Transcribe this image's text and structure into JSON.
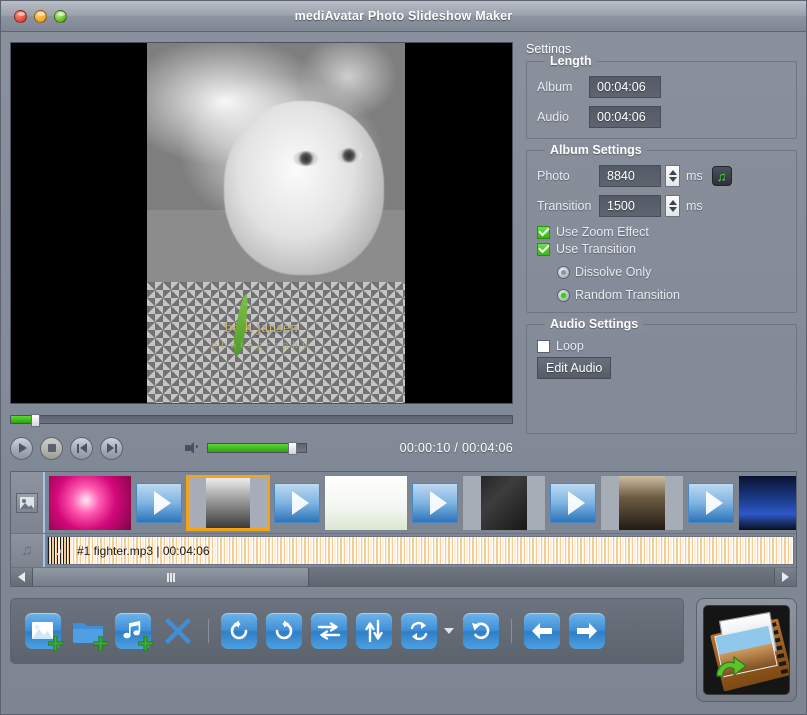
{
  "window": {
    "title": "mediAvatar Photo Slideshow Maker",
    "traffic_lights": [
      "close",
      "minimize",
      "maximize"
    ]
  },
  "preview": {
    "watermark_main": "beth jansen",
    "watermark_sub": "photography"
  },
  "player": {
    "play_label": "Play",
    "stop_label": "Stop",
    "previous_label": "Previous",
    "next_label": "Next",
    "volume_label": "Volume",
    "seek_percent": 4,
    "volume_percent": 82,
    "timecode": "00:00:10 / 00:04:06",
    "current_time": "00:00:10",
    "total_time": "00:04:06"
  },
  "settings": {
    "title": "Settings",
    "length": {
      "legend": "Length",
      "album_label": "Album",
      "album_value": "00:04:06",
      "audio_label": "Audio",
      "audio_value": "00:04:06"
    },
    "album": {
      "legend": "Album Settings",
      "photo_label": "Photo",
      "photo_value": "8840",
      "photo_unit": "ms",
      "transition_label": "Transition",
      "transition_value": "1500",
      "transition_unit": "ms",
      "zoom_effect_label": "Use Zoom Effect",
      "zoom_effect_checked": true,
      "use_transition_label": "Use Transition",
      "use_transition_checked": true,
      "dissolve_only_label": "Dissolve Only",
      "dissolve_only_selected": false,
      "random_transition_label": "Random Transition",
      "random_transition_selected": true
    },
    "audio": {
      "legend": "Audio Settings",
      "loop_label": "Loop",
      "loop_checked": false,
      "edit_audio_label": "Edit Audio"
    }
  },
  "timeline": {
    "photo_track_icon": "image-icon",
    "audio_track_icon": "music-note-icon",
    "items": [
      {
        "type": "photo",
        "name": "orchid-flower-thumbnail",
        "class": "img-orchid",
        "selected": false,
        "letterbox": false
      },
      {
        "type": "transition",
        "name": "transition-marker"
      },
      {
        "type": "photo",
        "name": "child-portrait-thumbnail",
        "class": "img-girl",
        "selected": true,
        "letterbox": true
      },
      {
        "type": "transition",
        "name": "transition-marker"
      },
      {
        "type": "photo",
        "name": "white-tulips-thumbnail",
        "class": "img-tulip",
        "selected": false,
        "letterbox": false
      },
      {
        "type": "transition",
        "name": "transition-marker"
      },
      {
        "type": "photo",
        "name": "dark-portrait-thumbnail",
        "class": "img-dark",
        "selected": false,
        "letterbox": true
      },
      {
        "type": "transition",
        "name": "transition-marker"
      },
      {
        "type": "photo",
        "name": "woman-portrait-thumbnail",
        "class": "img-lady",
        "selected": false,
        "letterbox": true
      },
      {
        "type": "transition",
        "name": "transition-marker"
      },
      {
        "type": "photo",
        "name": "night-building-thumbnail",
        "class": "img-city",
        "selected": false,
        "letterbox": false
      }
    ],
    "audio_clip": {
      "label": "#1 fighter.mp3 | 00:04:06",
      "track_number": "#1",
      "filename": "fighter.mp3",
      "duration": "00:04:06"
    },
    "scrollbar": {
      "left_arrow": "scroll-left",
      "right_arrow": "scroll-right"
    }
  },
  "toolbar": {
    "buttons": [
      {
        "name": "add-photo-button",
        "icon": "image-plus-icon",
        "label": "Add Photo"
      },
      {
        "name": "add-folder-button",
        "icon": "folder-plus-icon",
        "label": "Add Folder"
      },
      {
        "name": "add-music-button",
        "icon": "music-plus-icon",
        "label": "Add Music"
      },
      {
        "name": "delete-button",
        "icon": "close-x-icon",
        "label": "Delete"
      },
      {
        "name": "rotate-left-button",
        "icon": "rotate-ccw-icon",
        "label": "Rotate Left"
      },
      {
        "name": "rotate-right-button",
        "icon": "rotate-cw-icon",
        "label": "Rotate Right"
      },
      {
        "name": "flip-horizontal-button",
        "icon": "flip-horizontal-icon",
        "label": "Flip Horizontal"
      },
      {
        "name": "flip-vertical-button",
        "icon": "flip-vertical-icon",
        "label": "Flip Vertical"
      },
      {
        "name": "transition-button",
        "icon": "refresh-cycle-icon",
        "label": "Transition"
      },
      {
        "name": "reset-button",
        "icon": "undo-icon",
        "label": "Reset"
      },
      {
        "name": "move-left-button",
        "icon": "arrow-left-icon",
        "label": "Move Left"
      },
      {
        "name": "move-right-button",
        "icon": "arrow-right-icon",
        "label": "Move Right"
      }
    ],
    "export_label": "Build Slideshow"
  },
  "colors": {
    "window_bg": "#848b99",
    "accent_blue": "#3f8fd8",
    "accent_green": "#2fd110",
    "selection_orange": "#f2a31e",
    "field_bg": "#565d68",
    "waveform": "#f6cc92"
  }
}
